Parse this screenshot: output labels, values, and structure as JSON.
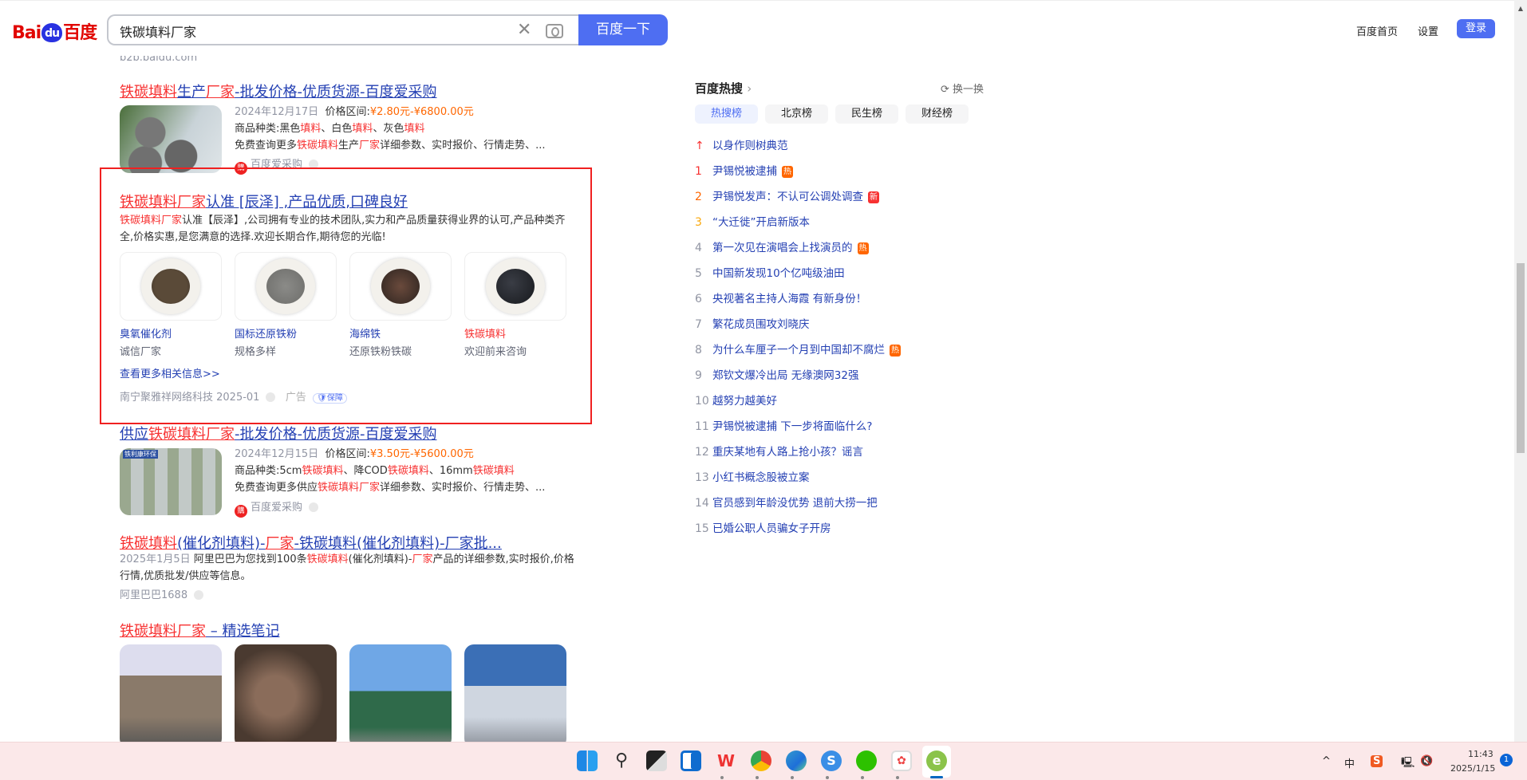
{
  "header": {
    "logo_text": "Baidu百度",
    "logo_left": "Bai",
    "logo_paw": "du",
    "logo_right": "百度",
    "query": "铁碳填料厂家",
    "search_button": "百度一下",
    "nav_home": "百度首页",
    "nav_settings": "设置",
    "login": "登录"
  },
  "prev_source": "b2b.baidu.com",
  "results": [
    {
      "title": [
        [
          "铁碳填料",
          1
        ],
        [
          "生产",
          0
        ],
        [
          "厂家",
          1
        ],
        [
          "-批发价格-优质货源-百度爱采购",
          0
        ]
      ],
      "date": "2024年12月17日",
      "price_label": "价格区间:",
      "price": "¥2.80元-¥6800.00元",
      "line2": [
        [
          "商品种类:黑色",
          0
        ],
        [
          "填料",
          1
        ],
        [
          "、白色",
          0
        ],
        [
          "填料",
          1
        ],
        [
          "、灰色",
          0
        ],
        [
          "填料",
          1
        ]
      ],
      "line3": [
        [
          "免费查询更多",
          0
        ],
        [
          "铁碳填料",
          1
        ],
        [
          "生产",
          0
        ],
        [
          "厂家",
          1
        ],
        [
          "详细参数、实时报价、行情走势、...",
          0
        ]
      ],
      "source": "百度爱采购"
    },
    {
      "title": [
        [
          "供应",
          0
        ],
        [
          "铁碳填料",
          1
        ],
        [
          "厂家",
          1
        ],
        [
          "-批发价格-优质货源-百度爱采购",
          0
        ]
      ],
      "date": "2024年12月15日",
      "price_label": "价格区间:",
      "price": "¥3.50元-¥5600.00元",
      "line2": [
        [
          "商品种类:5cm",
          0
        ],
        [
          "铁碳填料",
          1
        ],
        [
          "、降COD",
          0
        ],
        [
          "铁碳填料",
          1
        ],
        [
          "、16mm",
          0
        ],
        [
          "铁碳填料",
          1
        ]
      ],
      "line3": [
        [
          "免费查询更多供应",
          0
        ],
        [
          "铁碳填料",
          1
        ],
        [
          "厂家",
          1
        ],
        [
          "详细参数、实时报价、行情走势、...",
          0
        ]
      ],
      "source": "百度爱采购",
      "thumb_label": "铁利康环保"
    }
  ],
  "ad": {
    "title": [
      [
        "铁碳填料厂家",
        1
      ],
      [
        "认准 [辰泽] ,产品优质,口碑良好",
        0
      ]
    ],
    "desc": [
      [
        "铁碳填料厂家",
        1
      ],
      [
        "认准【辰泽】,公司拥有专业的技术团队,实力和产品质量获得业界的认可,产品种类齐",
        0
      ]
    ],
    "desc2": "全,价格实惠,是您满意的选择.欢迎长期合作,期待您的光临!",
    "cards": [
      {
        "name": "臭氧催化剂",
        "sub": "诚信厂家",
        "red": false
      },
      {
        "name": "国标还原铁粉",
        "sub": "规格多样",
        "red": false
      },
      {
        "name": "海绵铁",
        "sub": "还原铁粉铁碳",
        "red": false
      },
      {
        "name": "铁碳填料",
        "sub": "欢迎前来咨询",
        "red": true
      }
    ],
    "more": "查看更多相关信息>>",
    "advertiser": "南宁聚雅祥网络科技 2025-01",
    "ad_label": "广告",
    "guarantee": "保障"
  },
  "result4": {
    "title": [
      [
        "铁碳填料",
        1
      ],
      [
        "(催化剂填料)-",
        0
      ],
      [
        "厂家",
        1
      ],
      [
        "-铁碳填料(催化剂填料)-厂家批...",
        0
      ]
    ],
    "date": "2025年1月5日",
    "line1": [
      [
        "阿里巴巴为您找到100条",
        0
      ],
      [
        "铁碳填料",
        1
      ],
      [
        "(催化剂填料)-",
        0
      ],
      [
        "厂家",
        1
      ],
      [
        "产品的详细参数,实时报价,价格",
        0
      ]
    ],
    "line2": "行情,优质批发/供应等信息。",
    "source": "阿里巴巴1688"
  },
  "result5": {
    "title": [
      [
        "铁碳填料厂家",
        1
      ],
      [
        " – 精选笔记",
        0
      ]
    ]
  },
  "hot": {
    "title": "百度热搜",
    "refresh": "换一换",
    "tabs": [
      "热搜榜",
      "北京榜",
      "民生榜",
      "财经榜"
    ],
    "pinned": "以身作则树典范",
    "items": [
      {
        "n": "1",
        "t": "尹锡悦被逮捕",
        "badge": "热"
      },
      {
        "n": "2",
        "t": "尹锡悦发声：不认可公调处调查",
        "badge": "新"
      },
      {
        "n": "3",
        "t": "“大迁徙”开启新版本",
        "badge": ""
      },
      {
        "n": "4",
        "t": "第一次见在演唱会上找演员的",
        "badge": "热"
      },
      {
        "n": "5",
        "t": "中国新发现10个亿吨级油田",
        "badge": ""
      },
      {
        "n": "6",
        "t": "央视著名主持人海霞 有新身份！",
        "badge": ""
      },
      {
        "n": "7",
        "t": "繁花成员围攻刘晓庆",
        "badge": ""
      },
      {
        "n": "8",
        "t": "为什么车厘子一个月到中国却不腐烂",
        "badge": "热"
      },
      {
        "n": "9",
        "t": "郑钦文爆冷出局 无缘澳网32强",
        "badge": ""
      },
      {
        "n": "10",
        "t": "越努力越美好",
        "badge": ""
      },
      {
        "n": "11",
        "t": "尹锡悦被逮捕 下一步将面临什么?",
        "badge": ""
      },
      {
        "n": "12",
        "t": "重庆某地有人路上抢小孩？谣言",
        "badge": ""
      },
      {
        "n": "13",
        "t": "小红书概念股被立案",
        "badge": ""
      },
      {
        "n": "14",
        "t": "官员感到年龄没优势 退前大捞一把",
        "badge": ""
      },
      {
        "n": "15",
        "t": "已婚公职人员骗女子开房",
        "badge": ""
      }
    ]
  },
  "colors": {
    "rank1": "#f73131",
    "rank2": "#ff6600",
    "rank3": "#faa90e",
    "hot_badge": "#ff6600",
    "new_badge": "#f73131",
    "accent": "#4e6ef2"
  },
  "taskbar": {
    "time": "11:43",
    "date": "2025/1/15",
    "ime": "中",
    "notif": "1"
  }
}
